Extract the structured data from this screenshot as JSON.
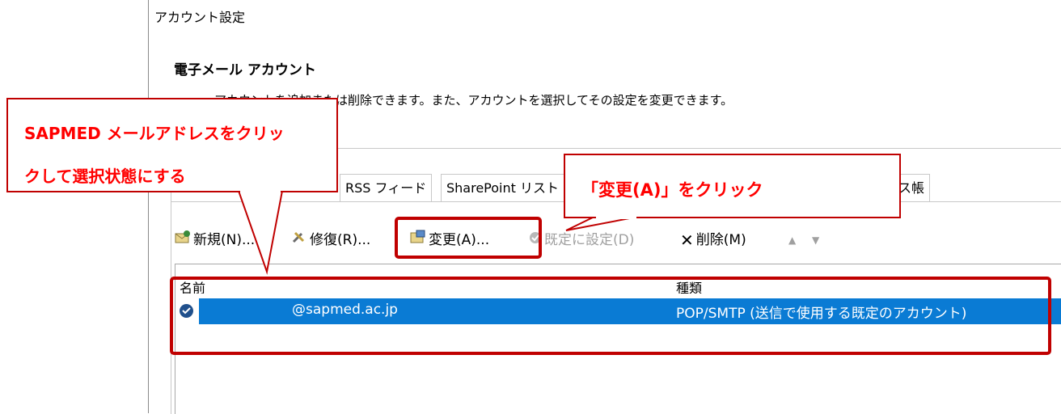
{
  "window": {
    "title": "アカウント設定"
  },
  "section": {
    "heading": "電子メール アカウント",
    "description": "アカウントを追加または削除できます。また、アカウントを選択してその設定を変更できます。"
  },
  "tabs": [
    {
      "label": "RSS フィード"
    },
    {
      "label": "SharePoint リスト"
    },
    {
      "label": "アドレス帳"
    }
  ],
  "toolbar": {
    "new_label": "新規(N)...",
    "repair_label": "修復(R)...",
    "change_label": "変更(A)...",
    "default_label": "既定に設定(D)",
    "delete_label": "削除(M)"
  },
  "list": {
    "col_name": "名前",
    "col_type": "種類",
    "rows": [
      {
        "name": "@sapmed.ac.jp",
        "type": "POP/SMTP (送信で使用する既定のアカウント)"
      }
    ]
  },
  "callouts": {
    "select_line1": "SAPMED メールアドレスをクリッ",
    "select_line2": "クして選択状態にする",
    "change_click": "「変更(A)」をクリック"
  },
  "colors": {
    "accent_red": "#c00000",
    "callout_text": "#ff0000",
    "selection": "#0a7bd4"
  }
}
